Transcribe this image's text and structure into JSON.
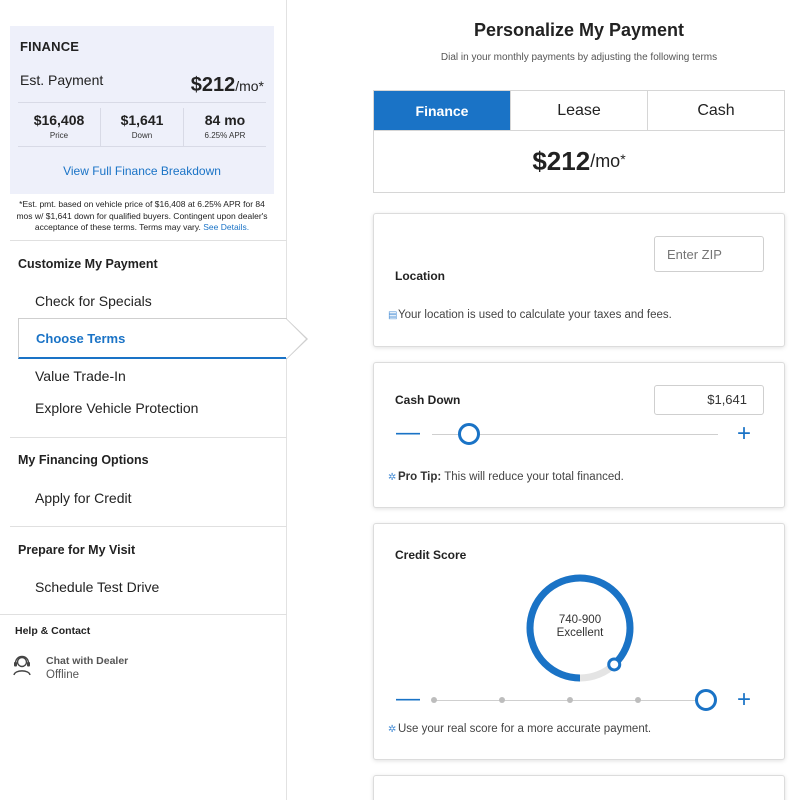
{
  "sidebar": {
    "finance_box": {
      "title": "FINANCE",
      "est_label": "Est. Payment",
      "est_amount": "$212",
      "est_unit": "/mo*",
      "stats": [
        {
          "value": "$16,408",
          "label": "Price"
        },
        {
          "value": "$1,641",
          "label": "Down"
        },
        {
          "value": "84 mo",
          "label": "6.25% APR"
        }
      ],
      "view_link": "View Full Finance Breakdown"
    },
    "disclaimer": "*Est. pmt. based on vehicle price of $16,408 at 6.25% APR for 84 mos w/ $1,641 down for qualified buyers. Contingent upon dealer's acceptance of these terms. Terms may vary.",
    "disclaimer_link": "See Details.",
    "sections": [
      {
        "heading": "Customize My Payment",
        "items": [
          "Check for Specials",
          "Choose Terms",
          "Value Trade-In",
          "Explore Vehicle Protection"
        ]
      },
      {
        "heading": "My Financing Options",
        "items": [
          "Apply for Credit"
        ]
      },
      {
        "heading": "Prepare for My Visit",
        "items": [
          "Schedule Test Drive"
        ]
      }
    ],
    "help": {
      "heading": "Help & Contact",
      "chat_label": "Chat with Dealer",
      "chat_status": "Offline"
    }
  },
  "main": {
    "title": "Personalize My Payment",
    "subtitle": "Dial in your monthly payments by adjusting the following terms",
    "tabs": [
      "Finance",
      "Lease",
      "Cash"
    ],
    "active_tab": "Finance",
    "payment_amount": "$212",
    "payment_unit": "/mo",
    "payment_suffix": "*",
    "location": {
      "title": "Location",
      "zip_placeholder": "Enter ZIP",
      "note": "Your location is used to calculate your taxes and fees."
    },
    "cash_down": {
      "title": "Cash Down",
      "value": "$1,641",
      "slider_fraction": 0.13,
      "minus": "—",
      "plus": "+",
      "tip_label": "Pro Tip:",
      "tip_text": " This will reduce your total financed."
    },
    "credit_score": {
      "title": "Credit Score",
      "range": "740-900",
      "rating": "Excellent",
      "gauge_fraction": 0.88,
      "slider_step": 4,
      "slider_steps": 5,
      "minus": "—",
      "plus": "+",
      "note": "Use your real score for a more accurate payment."
    }
  },
  "colors": {
    "accent": "#1a73c6",
    "finance_bg": "#eef0fa"
  }
}
